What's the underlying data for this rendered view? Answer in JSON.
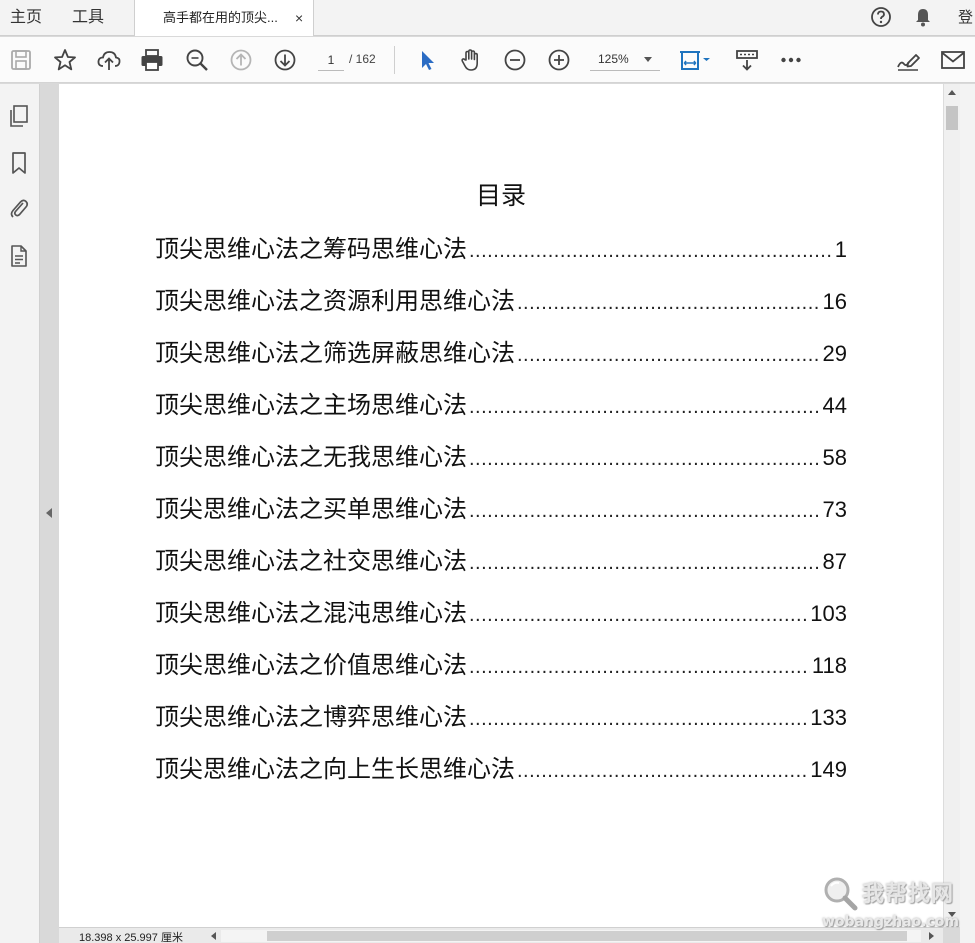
{
  "tabbar": {
    "home_label": "主页",
    "tools_label": "工具",
    "doc_tab_title": "高手都在用的顶尖...",
    "close_glyph": "×",
    "signin_label": "登"
  },
  "toolbar": {
    "current_page": "1",
    "total_pages": "/ 162",
    "zoom": "125%"
  },
  "icons": {
    "toolbar": [
      "save-icon",
      "star-icon",
      "upload-cloud-icon",
      "print-icon",
      "zoom-search-icon",
      "page-up-icon",
      "page-down-icon",
      "select-arrow-icon",
      "hand-icon",
      "zoom-out-icon",
      "zoom-in-icon",
      "fit-page-icon",
      "scroll-mode-icon",
      "more-icon",
      "sign-icon",
      "email-icon"
    ],
    "leftnav": [
      "pages-icon",
      "bookmark-icon",
      "attachment-icon",
      "document-icon"
    ],
    "topright": [
      "help-icon",
      "bell-icon"
    ]
  },
  "colors": {
    "accent": "#1e73be",
    "select_tool": "#2b6cc4"
  },
  "document": {
    "toc_title": "目录",
    "entries": [
      {
        "text": "顶尖思维心法之筹码思维心法",
        "page": "1"
      },
      {
        "text": "顶尖思维心法之资源利用思维心法",
        "page": "16"
      },
      {
        "text": "顶尖思维心法之筛选屏蔽思维心法",
        "page": "29"
      },
      {
        "text": "顶尖思维心法之主场思维心法",
        "page": "44"
      },
      {
        "text": "顶尖思维心法之无我思维心法",
        "page": "58"
      },
      {
        "text": "顶尖思维心法之买单思维心法",
        "page": "73"
      },
      {
        "text": "顶尖思维心法之社交思维心法",
        "page": "87"
      },
      {
        "text": "顶尖思维心法之混沌思维心法",
        "page": "103"
      },
      {
        "text": "顶尖思维心法之价值思维心法",
        "page": "118"
      },
      {
        "text": "顶尖思维心法之博弈思维心法",
        "page": "133"
      },
      {
        "text": "顶尖思维心法之向上生长思维心法",
        "page": "149"
      }
    ]
  },
  "status": {
    "page_size": "18.398 x 25.997 厘米"
  },
  "watermark": {
    "cn": "我帮找网",
    "en": "wobangzhao.com"
  }
}
